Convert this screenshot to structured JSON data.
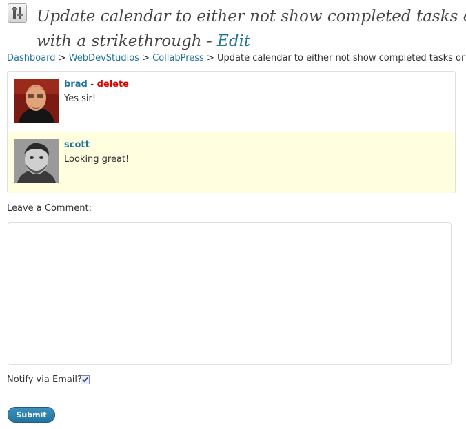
{
  "header": {
    "title_line1": "Update calendar to either not show completed tasks or show",
    "title_line2": "with a strikethrough - ",
    "edit_label": "Edit"
  },
  "breadcrumb": {
    "items": [
      "Dashboard",
      "WebDevStudios",
      "CollabPress"
    ],
    "separator": ">",
    "current": "Update calendar to either not show completed tasks or show"
  },
  "comments": [
    {
      "author": "brad",
      "separator": "-",
      "delete_label": "delete",
      "text": "Yes sir!"
    },
    {
      "author": "scott",
      "text": "Looking great!"
    }
  ],
  "form": {
    "leave_comment_label": "Leave a Comment:",
    "comment_value": "",
    "notify_label": "Notify via Email?",
    "notify_checked": true,
    "submit_label": "Submit"
  },
  "colors": {
    "link": "#21759b",
    "delete": "#e00000",
    "highlight_row": "#ffffe0",
    "button": "#21759b"
  },
  "icons": {
    "page_icon": "tools-icon",
    "checkbox": "checkmark-icon"
  }
}
